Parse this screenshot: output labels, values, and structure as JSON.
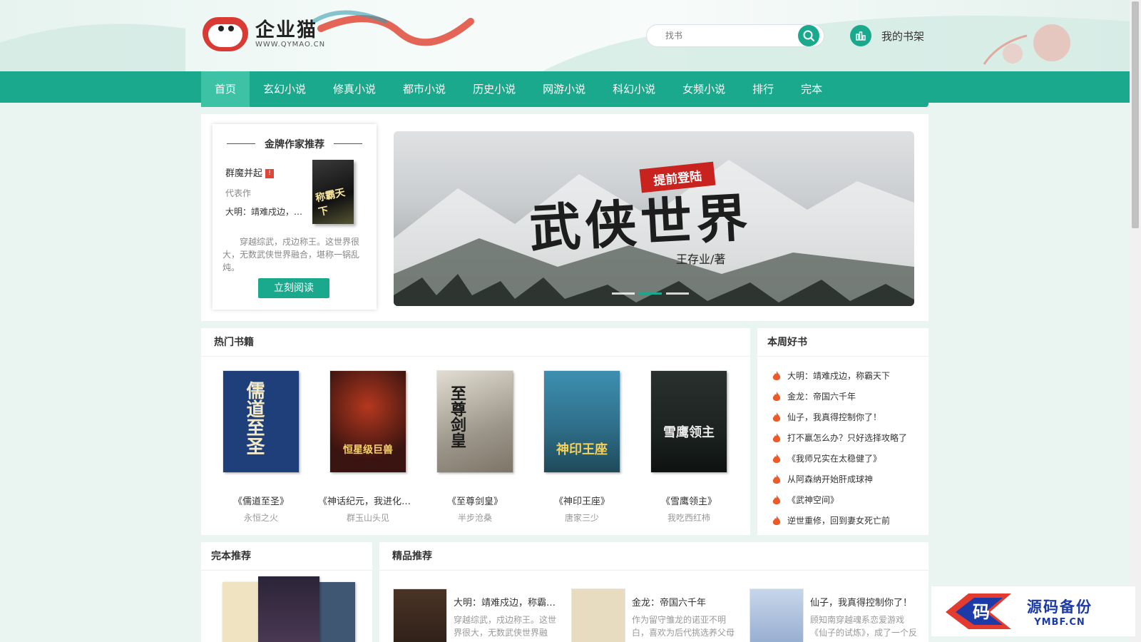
{
  "header": {
    "logo_text": "企业猫",
    "logo_url_text": "WWW.QYMAO.CN",
    "search_placeholder": "找书",
    "shelf_label": "我的书架"
  },
  "nav": {
    "items": [
      "首页",
      "玄幻小说",
      "修真小说",
      "都市小说",
      "历史小说",
      "网游小说",
      "科幻小说",
      "女频小说",
      "排行",
      "完本"
    ],
    "active_index": 0
  },
  "author_card": {
    "title": "金牌作家推荐",
    "author": "群魔并起",
    "badge": "!",
    "label": "代表作",
    "work": "大明：靖难戍边，称霸天下",
    "cover_text": "称霸天下",
    "desc": "穿越综武，戍边称王。这世界很大，无数武侠世界融合，堪称一锅乱炖。",
    "button": "立刻阅读"
  },
  "banner": {
    "tag": "提前登陆",
    "title": "武侠世界",
    "author": "王存业/著",
    "slides": 3,
    "active_slide": 1
  },
  "hot_books": {
    "title": "热门书籍",
    "books": [
      {
        "name": "《儒道至圣》",
        "author": "永恒之火",
        "cover_text": "儒道至圣",
        "cover_bg": "#1f3f7a",
        "cover_fg": "#f2e9c8"
      },
      {
        "name": "《神话纪元，我进化成了恒星级巨兽》",
        "author": "群玉山头见",
        "cover_text": "恒星级巨兽",
        "cover_bg": "#3a1410",
        "cover_fg": "#f5d36a"
      },
      {
        "name": "《至尊剑皇》",
        "author": "半步沧桑",
        "cover_text": "至尊剑皇",
        "cover_bg": "#b9b6ae",
        "cover_fg": "#1a1a1a"
      },
      {
        "name": "《神印王座》",
        "author": "唐家三少",
        "cover_text": "神印王座",
        "cover_bg": "#2f6f8a",
        "cover_fg": "#f4d15a"
      },
      {
        "name": "《雪鹰领主》",
        "author": "我吃西红柿",
        "cover_text": "雪鹰领主",
        "cover_bg": "#1c2321",
        "cover_fg": "#e9e9e9"
      }
    ]
  },
  "week_books": {
    "title": "本周好书",
    "items": [
      "大明：靖难戍边，称霸天下",
      "金龙：帝国六千年",
      "仙子，我真得控制你了！",
      "打不赢怎么办？只好选择攻略了",
      "《我师兄实在太稳健了》",
      "从阿森纳开始肝成球神",
      "《武神空间》",
      "逆世重修，回到妻女死亡前"
    ]
  },
  "full_books": {
    "title": "完本推荐"
  },
  "fine_books": {
    "title": "精品推荐",
    "items": [
      {
        "title": "大明：靖难戍边，称霸天下",
        "desc": "穿越综武，戍边称王。这世界很大，无数武侠世界融合，堪称一锅乱炖。",
        "cover_bg": "#3b2a20"
      },
      {
        "title": "金龙：帝国六千年",
        "desc": "作为留守雏龙的诺亚不明白，喜欢为后代挑选养父母的习惯从何而来。",
        "cover_bg": "#e8dcc0"
      },
      {
        "title": "仙子，我真得控制你了！",
        "desc": "顾知南穿越魂系恋爱游戏《仙子的试炼》，成了一个反派。",
        "cover_bg": "#9fb6d6"
      }
    ]
  },
  "watermark": {
    "main": "源码备份",
    "sub": "YMBF.CN",
    "mark": "码"
  },
  "colors": {
    "accent": "#1aa98c",
    "accent_light": "#3dc2a6",
    "page_bg": "#eaf5f2"
  }
}
